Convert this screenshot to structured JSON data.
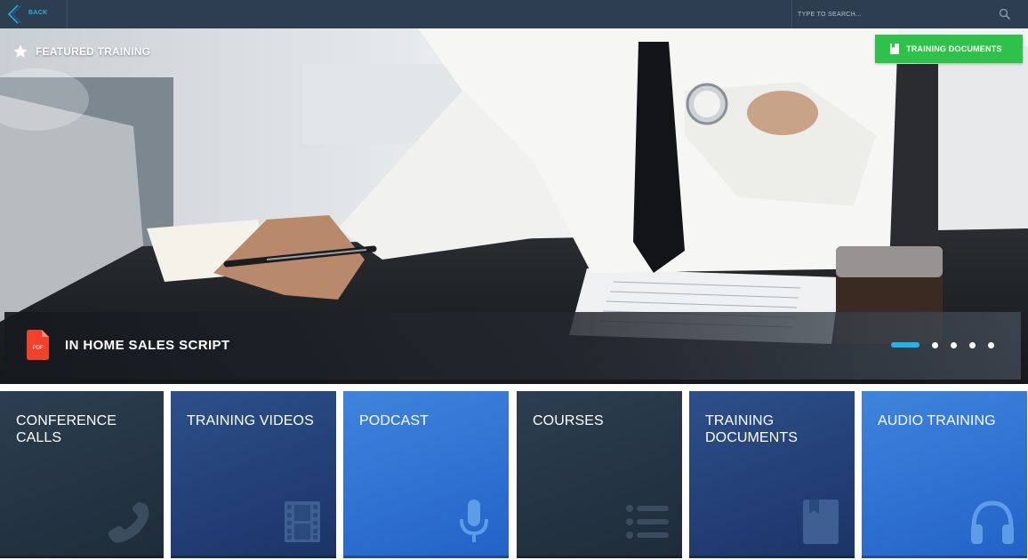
{
  "topbar": {
    "back_label": "BACK",
    "search_placeholder": "TYPE TO SEARCH...",
    "search_icon": "search-icon"
  },
  "hero": {
    "featured_label": "FEATURED TRAINING",
    "featured_icon": "star-icon",
    "documents_button_label": "TRAINING DOCUMENTS",
    "documents_button_icon": "book-icon",
    "caption_title": "IN HOME SALES SCRIPT",
    "caption_icon_label": "PDF",
    "carousel": {
      "slide_count": 5,
      "active_index": 0
    }
  },
  "tiles": [
    {
      "label": "CONFERENCE CALLS",
      "icon": "phone-icon"
    },
    {
      "label": "TRAINING VIDEOS",
      "icon": "film-icon"
    },
    {
      "label": "PODCAST",
      "icon": "microphone-icon"
    },
    {
      "label": "COURSES",
      "icon": "list-icon"
    },
    {
      "label": "TRAINING DOCUMENTS",
      "icon": "book-icon"
    },
    {
      "label": "AUDIO TRAINING",
      "icon": "headphones-icon"
    }
  ],
  "colors": {
    "topbar": "#2c3e50",
    "accent_blue": "#1fb4ea",
    "documents_button": "#2ec24a",
    "pdf_red": "#f0412a"
  }
}
